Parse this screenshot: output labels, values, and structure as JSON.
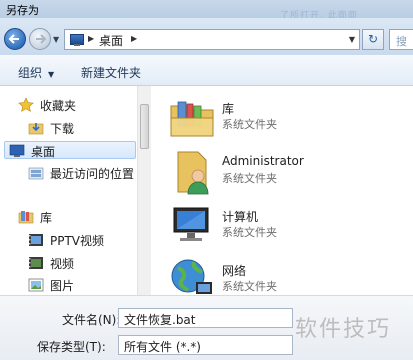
{
  "window": {
    "title": "另存为",
    "blurred_title_text": "了所打开, 此面面"
  },
  "address": {
    "crumbs": [
      "桌面"
    ],
    "refresh_glyph": "↻",
    "search_glyph": "搜"
  },
  "toolbar": {
    "organize": "组织",
    "new_folder": "新建文件夹"
  },
  "nav": {
    "favorites_label": "收藏夹",
    "items": [
      {
        "label": "下载",
        "icon": "download-folder-icon"
      },
      {
        "label": "桌面",
        "icon": "desktop-icon",
        "selected": true
      },
      {
        "label": "最近访问的位置",
        "icon": "recent-places-icon"
      }
    ],
    "libraries_label": "库",
    "lib_items": [
      {
        "label": "PPTV视频",
        "icon": "video-library-icon"
      },
      {
        "label": "视频",
        "icon": "video-library-icon"
      },
      {
        "label": "图片",
        "icon": "picture-library-icon"
      }
    ]
  },
  "files": [
    {
      "name": "库",
      "type": "系统文件夹",
      "icon": "libraries-folder-icon"
    },
    {
      "name": "Administrator",
      "type": "系统文件夹",
      "icon": "user-folder-icon"
    },
    {
      "name": "计算机",
      "type": "系统文件夹",
      "icon": "computer-icon"
    },
    {
      "name": "网络",
      "type": "系统文件夹",
      "icon": "network-globe-icon"
    }
  ],
  "fields": {
    "filename_label": "文件名(N):",
    "filename_value": "文件恢复.bat",
    "savetype_label": "保存类型(T):",
    "savetype_value": "所有文件 (*.*)"
  },
  "watermark": "软件技巧"
}
